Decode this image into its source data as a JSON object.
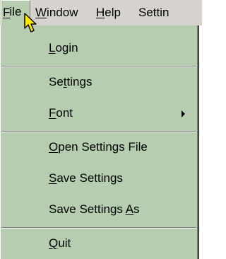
{
  "menubar": {
    "items": [
      {
        "pre": "",
        "mnemonic": "F",
        "post": "ile"
      },
      {
        "pre": "",
        "mnemonic": "W",
        "post": "indow"
      },
      {
        "pre": "",
        "mnemonic": "H",
        "post": "elp"
      },
      {
        "pre": "Settin",
        "mnemonic": "",
        "post": ""
      }
    ]
  },
  "file_menu": {
    "items": [
      {
        "pre": "",
        "mnemonic": "L",
        "post": "ogin"
      },
      {
        "pre": "Se",
        "mnemonic": "t",
        "post": "tings"
      },
      {
        "pre": "",
        "mnemonic": "F",
        "post": "ont"
      },
      {
        "pre": "",
        "mnemonic": "O",
        "post": "pen Settings File"
      },
      {
        "pre": "",
        "mnemonic": "S",
        "post": "ave Settings"
      },
      {
        "pre": "Save Settings ",
        "mnemonic": "A",
        "post": "s"
      },
      {
        "pre": "",
        "mnemonic": "Q",
        "post": "uit"
      }
    ]
  },
  "icons": {
    "submenu_arrow": "triangle-right-icon",
    "pointer": "arrow-cursor-icon"
  },
  "colors": {
    "menu_background": "#b7cdb0",
    "menubar_background": "#d6d3ce"
  }
}
